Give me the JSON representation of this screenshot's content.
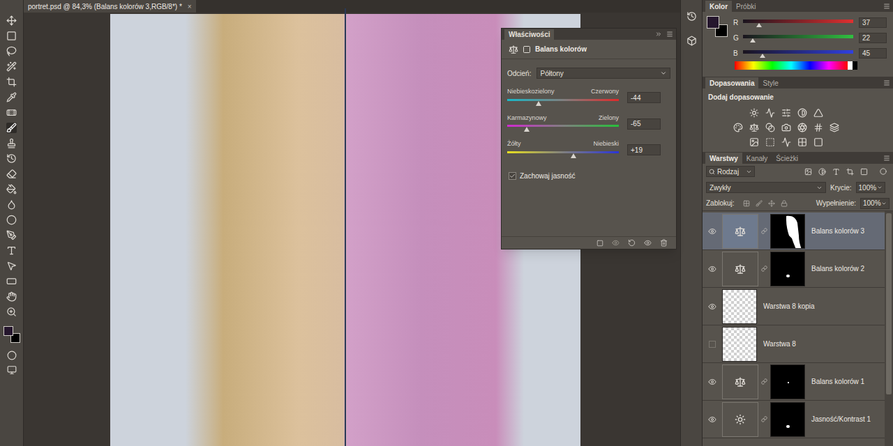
{
  "document_tab": {
    "title": "portret.psd @ 84,3% (Balans kolorów 3,RGB/8*) *",
    "close": "×"
  },
  "properties": {
    "title": "Właściwości",
    "adjustment": "Balans kolorów",
    "tone_label": "Odcień:",
    "tone_value": "Półtony",
    "sliders": [
      {
        "left": "Niebieskozielony",
        "right": "Czerwony",
        "value": "-44",
        "level": 0.28,
        "color_from": "#18b8c8",
        "color_to": "#e02a2a"
      },
      {
        "left": "Karmazynowy",
        "right": "Zielony",
        "value": "-65",
        "level": 0.175,
        "color_from": "#d02ad0",
        "color_to": "#26c03a"
      },
      {
        "left": "Żółty",
        "right": "Niebieski",
        "value": "+19",
        "level": 0.595,
        "color_from": "#e8e020",
        "color_to": "#2a34d8"
      }
    ],
    "preserve": {
      "label": "Zachowaj jasność",
      "checked": true
    }
  },
  "color_panel": {
    "tabs": [
      {
        "label": "Kolor",
        "selected": true
      },
      {
        "label": "Próbki",
        "selected": false
      }
    ],
    "foreground": "#25162d",
    "channels": [
      {
        "name": "R",
        "value": "37",
        "level": 0.145,
        "color": "#e03030"
      },
      {
        "name": "G",
        "value": "22",
        "level": 0.086,
        "color": "#30c040"
      },
      {
        "name": "B",
        "value": "45",
        "level": 0.176,
        "color": "#3040e0"
      }
    ]
  },
  "adjustments_panel": {
    "tabs": [
      {
        "label": "Dopasowania",
        "selected": true
      },
      {
        "label": "Style",
        "selected": false
      }
    ],
    "heading": "Dodaj dopasowanie"
  },
  "layers_panel": {
    "tabs": [
      {
        "label": "Warstwy",
        "selected": true
      },
      {
        "label": "Kanały",
        "selected": false
      },
      {
        "label": "Ścieżki",
        "selected": false
      }
    ],
    "filter": "Rodzaj",
    "blend_mode": "Zwykły",
    "opacity_label": "Krycie:",
    "opacity": "100%",
    "lock_label": "Zablokuj:",
    "fill_label": "Wypełnienie:",
    "fill": "100%",
    "layers": [
      {
        "name": "Balans kolorów 3",
        "kind": "color-balance",
        "mask": "hair",
        "visible": true,
        "selected": true
      },
      {
        "name": "Balans kolorów 2",
        "kind": "color-balance",
        "mask": "spot",
        "visible": true,
        "selected": false
      },
      {
        "name": "Warstwa 8 kopia",
        "kind": "pixel",
        "mask": "none",
        "visible": true,
        "selected": false
      },
      {
        "name": "Warstwa 8",
        "kind": "pixel",
        "mask": "none",
        "visible": false,
        "selected": false
      },
      {
        "name": "Balans kolorów 1",
        "kind": "color-balance",
        "mask": "dot",
        "visible": true,
        "selected": false
      },
      {
        "name": "Jasność/Kontrast 1",
        "kind": "brightness-contrast",
        "mask": "spot",
        "visible": true,
        "selected": false
      }
    ]
  }
}
